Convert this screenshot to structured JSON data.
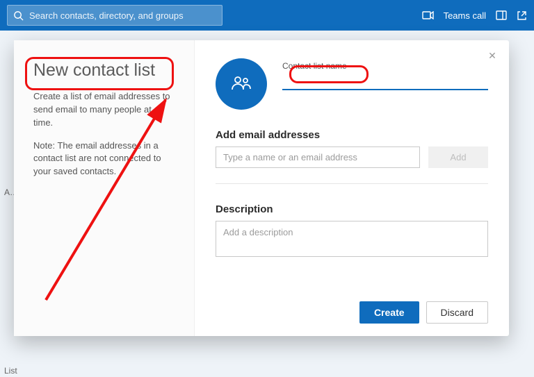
{
  "topbar": {
    "search_placeholder": "Search contacts, directory, and groups",
    "teams_call": "Teams call"
  },
  "background": {
    "token_a": "A…",
    "token_list": "List"
  },
  "modal": {
    "title": "New contact list",
    "desc_line1": "Create a list of email addresses to send email to many people at a time.",
    "desc_line2": "Note: The email addresses in a contact list are not connected to your saved contacts.",
    "name_label": "Contact list name",
    "name_value": "",
    "emails_heading": "Add email addresses",
    "email_placeholder": "Type a name or an email address",
    "add_label": "Add",
    "description_heading": "Description",
    "description_placeholder": "Add a description",
    "create_label": "Create",
    "discard_label": "Discard"
  },
  "colors": {
    "accent": "#0f6cbd",
    "annotation": "#e11"
  }
}
